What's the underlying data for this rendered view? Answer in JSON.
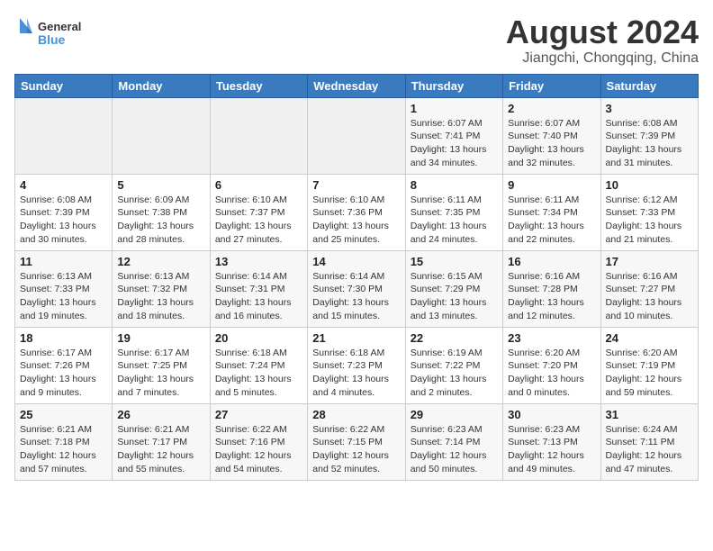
{
  "header": {
    "logo_line1": "General",
    "logo_line2": "Blue",
    "month_year": "August 2024",
    "location": "Jiangchi, Chongqing, China"
  },
  "weekdays": [
    "Sunday",
    "Monday",
    "Tuesday",
    "Wednesday",
    "Thursday",
    "Friday",
    "Saturday"
  ],
  "weeks": [
    [
      {
        "day": "",
        "info": ""
      },
      {
        "day": "",
        "info": ""
      },
      {
        "day": "",
        "info": ""
      },
      {
        "day": "",
        "info": ""
      },
      {
        "day": "1",
        "info": "Sunrise: 6:07 AM\nSunset: 7:41 PM\nDaylight: 13 hours\nand 34 minutes."
      },
      {
        "day": "2",
        "info": "Sunrise: 6:07 AM\nSunset: 7:40 PM\nDaylight: 13 hours\nand 32 minutes."
      },
      {
        "day": "3",
        "info": "Sunrise: 6:08 AM\nSunset: 7:39 PM\nDaylight: 13 hours\nand 31 minutes."
      }
    ],
    [
      {
        "day": "4",
        "info": "Sunrise: 6:08 AM\nSunset: 7:39 PM\nDaylight: 13 hours\nand 30 minutes."
      },
      {
        "day": "5",
        "info": "Sunrise: 6:09 AM\nSunset: 7:38 PM\nDaylight: 13 hours\nand 28 minutes."
      },
      {
        "day": "6",
        "info": "Sunrise: 6:10 AM\nSunset: 7:37 PM\nDaylight: 13 hours\nand 27 minutes."
      },
      {
        "day": "7",
        "info": "Sunrise: 6:10 AM\nSunset: 7:36 PM\nDaylight: 13 hours\nand 25 minutes."
      },
      {
        "day": "8",
        "info": "Sunrise: 6:11 AM\nSunset: 7:35 PM\nDaylight: 13 hours\nand 24 minutes."
      },
      {
        "day": "9",
        "info": "Sunrise: 6:11 AM\nSunset: 7:34 PM\nDaylight: 13 hours\nand 22 minutes."
      },
      {
        "day": "10",
        "info": "Sunrise: 6:12 AM\nSunset: 7:33 PM\nDaylight: 13 hours\nand 21 minutes."
      }
    ],
    [
      {
        "day": "11",
        "info": "Sunrise: 6:13 AM\nSunset: 7:33 PM\nDaylight: 13 hours\nand 19 minutes."
      },
      {
        "day": "12",
        "info": "Sunrise: 6:13 AM\nSunset: 7:32 PM\nDaylight: 13 hours\nand 18 minutes."
      },
      {
        "day": "13",
        "info": "Sunrise: 6:14 AM\nSunset: 7:31 PM\nDaylight: 13 hours\nand 16 minutes."
      },
      {
        "day": "14",
        "info": "Sunrise: 6:14 AM\nSunset: 7:30 PM\nDaylight: 13 hours\nand 15 minutes."
      },
      {
        "day": "15",
        "info": "Sunrise: 6:15 AM\nSunset: 7:29 PM\nDaylight: 13 hours\nand 13 minutes."
      },
      {
        "day": "16",
        "info": "Sunrise: 6:16 AM\nSunset: 7:28 PM\nDaylight: 13 hours\nand 12 minutes."
      },
      {
        "day": "17",
        "info": "Sunrise: 6:16 AM\nSunset: 7:27 PM\nDaylight: 13 hours\nand 10 minutes."
      }
    ],
    [
      {
        "day": "18",
        "info": "Sunrise: 6:17 AM\nSunset: 7:26 PM\nDaylight: 13 hours\nand 9 minutes."
      },
      {
        "day": "19",
        "info": "Sunrise: 6:17 AM\nSunset: 7:25 PM\nDaylight: 13 hours\nand 7 minutes."
      },
      {
        "day": "20",
        "info": "Sunrise: 6:18 AM\nSunset: 7:24 PM\nDaylight: 13 hours\nand 5 minutes."
      },
      {
        "day": "21",
        "info": "Sunrise: 6:18 AM\nSunset: 7:23 PM\nDaylight: 13 hours\nand 4 minutes."
      },
      {
        "day": "22",
        "info": "Sunrise: 6:19 AM\nSunset: 7:22 PM\nDaylight: 13 hours\nand 2 minutes."
      },
      {
        "day": "23",
        "info": "Sunrise: 6:20 AM\nSunset: 7:20 PM\nDaylight: 13 hours\nand 0 minutes."
      },
      {
        "day": "24",
        "info": "Sunrise: 6:20 AM\nSunset: 7:19 PM\nDaylight: 12 hours\nand 59 minutes."
      }
    ],
    [
      {
        "day": "25",
        "info": "Sunrise: 6:21 AM\nSunset: 7:18 PM\nDaylight: 12 hours\nand 57 minutes."
      },
      {
        "day": "26",
        "info": "Sunrise: 6:21 AM\nSunset: 7:17 PM\nDaylight: 12 hours\nand 55 minutes."
      },
      {
        "day": "27",
        "info": "Sunrise: 6:22 AM\nSunset: 7:16 PM\nDaylight: 12 hours\nand 54 minutes."
      },
      {
        "day": "28",
        "info": "Sunrise: 6:22 AM\nSunset: 7:15 PM\nDaylight: 12 hours\nand 52 minutes."
      },
      {
        "day": "29",
        "info": "Sunrise: 6:23 AM\nSunset: 7:14 PM\nDaylight: 12 hours\nand 50 minutes."
      },
      {
        "day": "30",
        "info": "Sunrise: 6:23 AM\nSunset: 7:13 PM\nDaylight: 12 hours\nand 49 minutes."
      },
      {
        "day": "31",
        "info": "Sunrise: 6:24 AM\nSunset: 7:11 PM\nDaylight: 12 hours\nand 47 minutes."
      }
    ]
  ]
}
